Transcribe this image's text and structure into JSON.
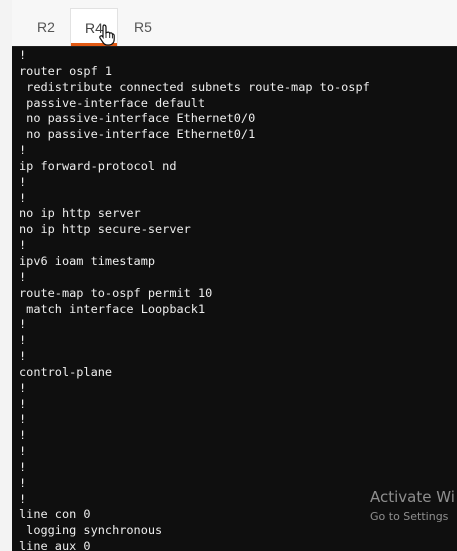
{
  "tabs": [
    {
      "label": "R2",
      "active": false
    },
    {
      "label": "R4",
      "active": true
    },
    {
      "label": "R5",
      "active": false
    }
  ],
  "colors": {
    "accent": "#e25a14",
    "terminal_background": "#0f0f0f",
    "terminal_text": "#eeeeee"
  },
  "icons": {
    "cursor": "hand-pointer-icon"
  },
  "terminal": {
    "lines": [
      "!",
      "router ospf 1",
      " redistribute connected subnets route-map to-ospf",
      " passive-interface default",
      " no passive-interface Ethernet0/0",
      " no passive-interface Ethernet0/1",
      "!",
      "ip forward-protocol nd",
      "!",
      "!",
      "no ip http server",
      "no ip http secure-server",
      "!",
      "ipv6 ioam timestamp",
      "!",
      "route-map to-ospf permit 10",
      " match interface Loopback1",
      "!",
      "!",
      "!",
      "control-plane",
      "!",
      "!",
      "!",
      "!",
      "!",
      "!",
      "!",
      "!",
      "line con 0",
      " logging synchronous",
      "line aux 0"
    ]
  },
  "watermark": {
    "title": "Activate Wi",
    "subtitle": "Go to Settings"
  }
}
